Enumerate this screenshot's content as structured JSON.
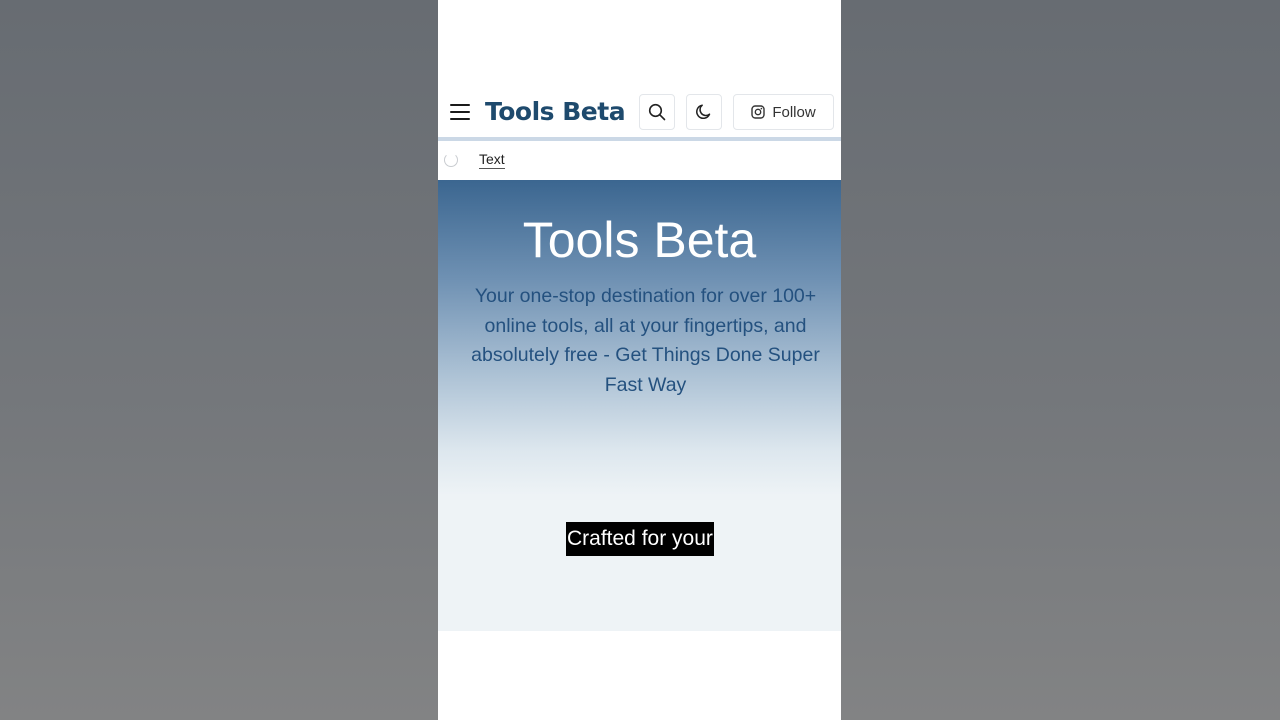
{
  "header": {
    "logo_text": "Tools Beta",
    "follow_label": "Follow",
    "icons": {
      "menu": "hamburger-menu-icon",
      "search": "search-icon",
      "theme": "moon-icon",
      "follow": "instagram-icon"
    },
    "brand_color": "#1e4a6d"
  },
  "subnav": {
    "link_label": "Text"
  },
  "hero": {
    "title": "Tools Beta",
    "subtitle": "Your one-stop destination for over 100+ online tools, all at your fingertips, and absolutely free - Get Things Done Super Fast Way",
    "gradient_top": "#3b6690",
    "gradient_bottom": "#eef3f6"
  },
  "caption": {
    "text": "Crafted for your"
  }
}
